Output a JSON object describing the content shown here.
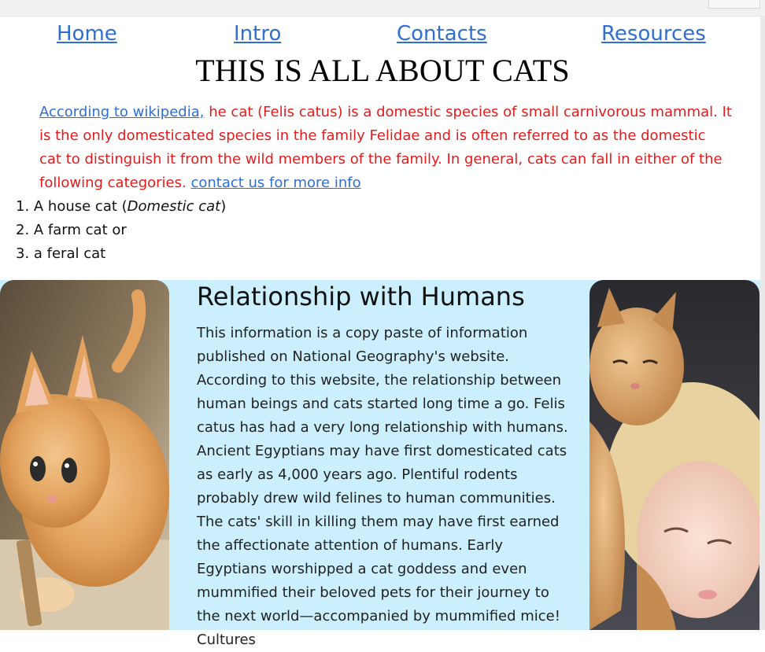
{
  "nav": {
    "home": "Home",
    "intro": "Intro",
    "contacts": "Contacts",
    "resources": "Resources"
  },
  "page_title": "THIS IS ALL ABOUT CATS",
  "intro": {
    "wiki_link": "According to wikipedia,",
    "text": " he cat (Felis catus) is a domestic species of small carnivorous mammal. It is the only domesticated species in the family Felidae and is often referred to as the domestic cat to distinguish it from the wild members of the family. In general, cats can fall in either of the following categories. ",
    "contact_link": "contact us for more info"
  },
  "categories": {
    "item1_prefix": "1. A house cat (",
    "item1_em": "Domestic cat",
    "item1_suffix": ")",
    "item2": "2. A farm cat or",
    "item3": "3. a feral cat"
  },
  "relationship": {
    "heading": "Relationship with Humans",
    "body": "This information is a copy paste of information published on National Geography's website. According to this website, the relationship between human beings and cats started long time a go. Felis catus has had a very long relationship with humans. Ancient Egyptians may have first domesticated cats as early as 4,000 years ago. Plentiful rodents probably drew wild felines to human communities. The cats' skill in killing them may have first earned the affectionate attention of humans. Early Egyptians worshipped a cat goddess and even mummified their beloved pets for their journey to the next world—accompanied by mummified mice! Cultures"
  },
  "colors": {
    "link": "#2f6fd1",
    "intro_text": "#e31b1b",
    "section_bg": "#cbeffc"
  }
}
